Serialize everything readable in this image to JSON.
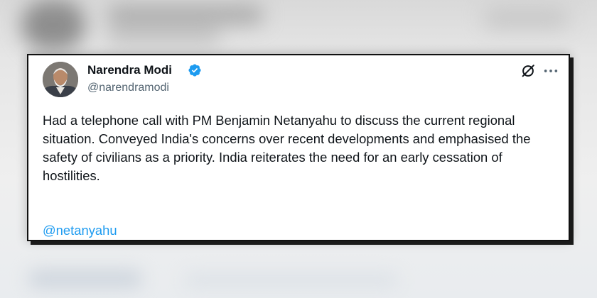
{
  "tweet": {
    "author": {
      "name": "Narendra Modi",
      "handle": "@narendramodi",
      "verified": true,
      "verified_color": "#1d9bf0"
    },
    "text": "Had a telephone call with PM Benjamin Netanyahu to discuss the current regional situation. Conveyed India's concerns over recent developments and emphasised the safety of civilians as a priority. India reiterates the need for an early cessation of hostilities.",
    "mention": "@netanyahu",
    "actions": {
      "grok_icon": "grok-icon",
      "more_icon": "more-horizontal-icon"
    }
  },
  "colors": {
    "text_primary": "#0f1419",
    "text_secondary": "#536471",
    "link": "#1d9bf0",
    "card_border": "#111111"
  }
}
